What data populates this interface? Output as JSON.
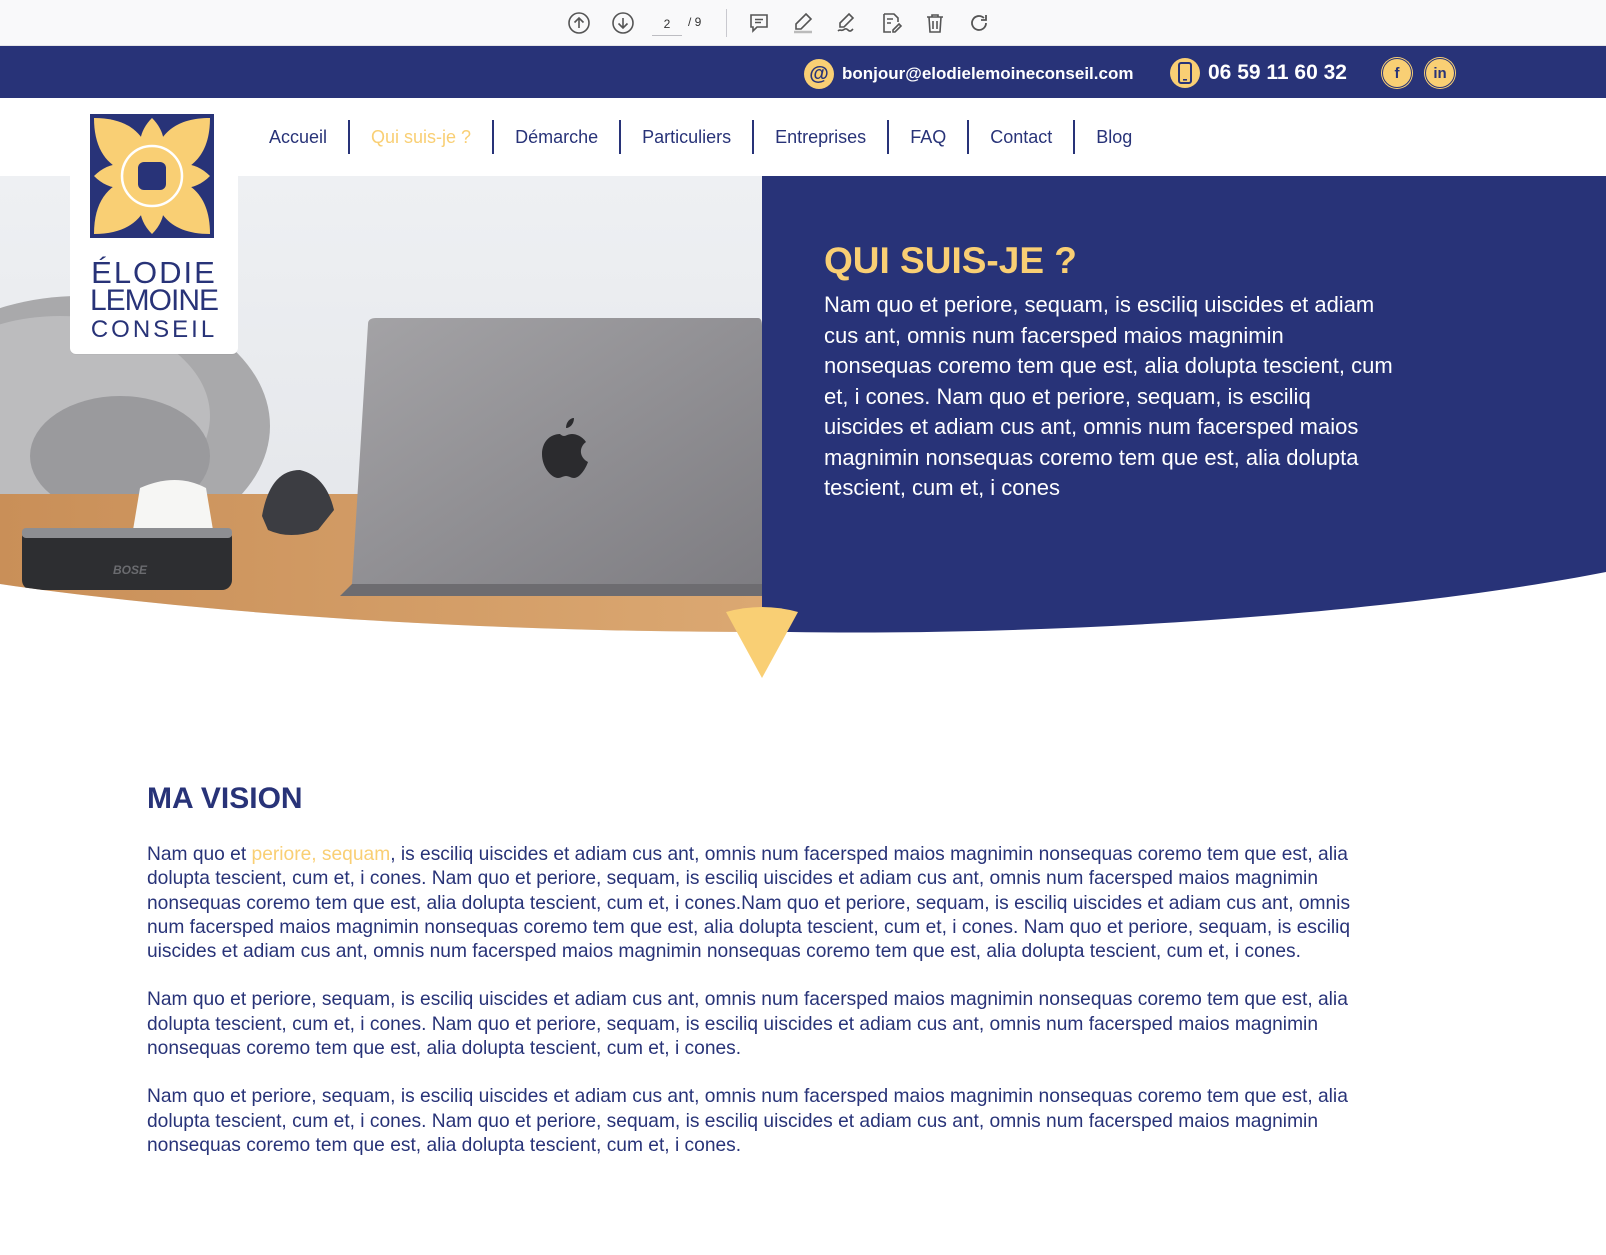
{
  "viewer": {
    "page_current": "2",
    "page_total": "/ 9",
    "icons": [
      "arrow-up-circle-icon",
      "arrow-down-circle-icon",
      "comment-icon",
      "highlight-pen-icon",
      "signature-icon",
      "edit-doc-icon",
      "trash-icon",
      "redo-icon"
    ]
  },
  "contact": {
    "email_symbol": "@",
    "email": "bonjour@elodielemoineconseil.com",
    "phone": "06 59 11 60 32",
    "facebook_glyph": "f",
    "linkedin_glyph": "in"
  },
  "logo": {
    "line1": "ÉLODIE",
    "line2": "LEMOINE",
    "line3": "CONSEIL"
  },
  "nav": {
    "items": [
      {
        "label": "Accueil"
      },
      {
        "label": "Qui suis-je ?"
      },
      {
        "label": "Démarche"
      },
      {
        "label": "Particuliers"
      },
      {
        "label": "Entreprises"
      },
      {
        "label": "FAQ"
      },
      {
        "label": "Contact"
      },
      {
        "label": "Blog"
      }
    ],
    "active_index": 1
  },
  "hero": {
    "title": "QUI SUIS-JE ?",
    "text": "Nam quo et periore, sequam, is esciliq uiscides et adiam cus ant, omnis num facersped maios magnimin nonsequas coremo tem que est, alia dolupta tescient, cum et, i cones. Nam quo et periore, sequam, is esciliq uiscides et adiam cus ant, omnis num facersped maios magnimin nonsequas coremo tem que est, alia dolupta tescient, cum et, i cones",
    "image_brand_text": "BOSE"
  },
  "vision": {
    "title": "MA VISION",
    "p1_start": "Nam quo et ",
    "p1_highlight": "periore, sequam",
    "p1_rest": ", is esciliq uiscides et adiam cus ant, omnis num facersped maios magnimin nonsequas coremo tem que est, alia dolupta tescient, cum et, i cones. Nam quo et periore, sequam, is esciliq uiscides et adiam cus ant, omnis num facersped maios magnimin nonsequas coremo tem que est, alia dolupta tescient, cum et, i cones.Nam quo et periore, sequam, is esciliq uiscides et adiam cus ant, omnis num facersped maios magnimin nonsequas coremo tem que est, alia dolupta tescient, cum et, i cones. Nam quo et periore, sequam, is esciliq uiscides et adiam cus ant, omnis num facersped maios magnimin nonsequas coremo tem que est, alia dolupta tescient, cum et, i cones.",
    "p2": "Nam quo et periore, sequam, is esciliq uiscides et adiam cus ant, omnis num facersped maios magnimin nonsequas coremo tem que est, alia dolupta tescient, cum et, i cones. Nam quo et periore, sequam, is esciliq uiscides et adiam cus ant, omnis num facersped maios magnimin nonsequas coremo tem que est, alia dolupta tescient, cum et, i cones.",
    "p3": "Nam quo et periore, sequam, is esciliq uiscides et adiam cus ant, omnis num facersped maios magnimin nonsequas coremo tem que est, alia dolupta tescient, cum et, i cones. Nam quo et periore, sequam, is esciliq uiscides et adiam cus ant, omnis num facersped maios magnimin nonsequas coremo tem que est, alia dolupta tescient, cum et, i cones."
  },
  "colors": {
    "navy": "#283378",
    "yellow": "#f9cf74",
    "white": "#ffffff"
  }
}
